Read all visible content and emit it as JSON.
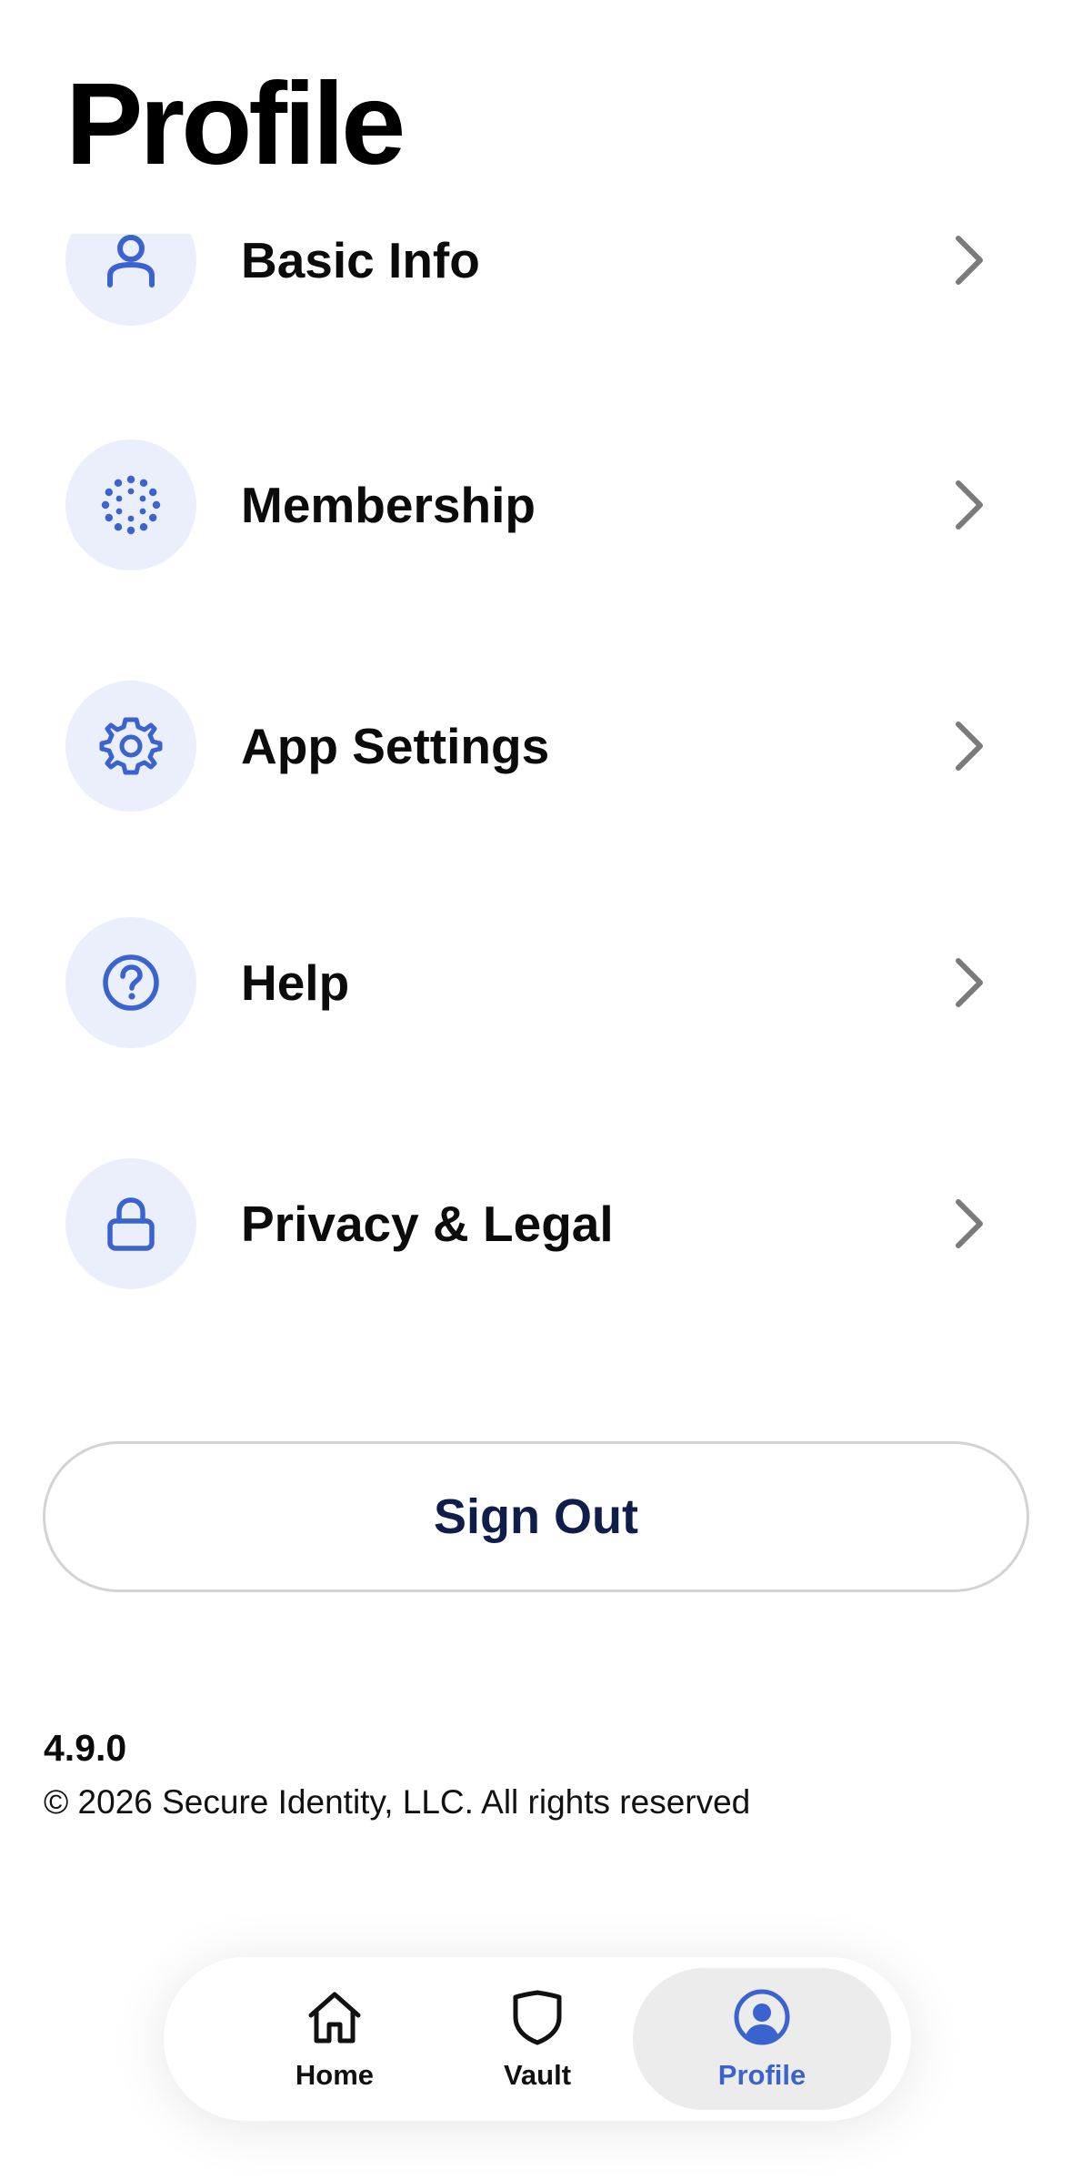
{
  "page": {
    "title": "Profile"
  },
  "menu": {
    "items": [
      {
        "label": "Basic Info",
        "icon": "person-icon"
      },
      {
        "label": "Membership",
        "icon": "dotted-circle-icon"
      },
      {
        "label": "App Settings",
        "icon": "gear-icon"
      },
      {
        "label": "Help",
        "icon": "question-circle-icon"
      },
      {
        "label": "Privacy & Legal",
        "icon": "lock-icon"
      }
    ]
  },
  "sign_out": {
    "label": "Sign Out"
  },
  "footer": {
    "version": "4.9.0",
    "copyright": "© 2026 Secure Identity, LLC. All rights reserved"
  },
  "tab_bar": {
    "tabs": [
      {
        "label": "Home",
        "icon": "home-icon",
        "active": false
      },
      {
        "label": "Vault",
        "icon": "shield-icon",
        "active": false
      },
      {
        "label": "Profile",
        "icon": "user-circle-icon",
        "active": true
      }
    ]
  },
  "colors": {
    "accent": "#3b63d0",
    "icon_circle_bg": "#eaeffb",
    "sign_out_text": "#0f1d4a",
    "chevron": "#7a7a7a",
    "active_tab_bg": "#ececec"
  }
}
